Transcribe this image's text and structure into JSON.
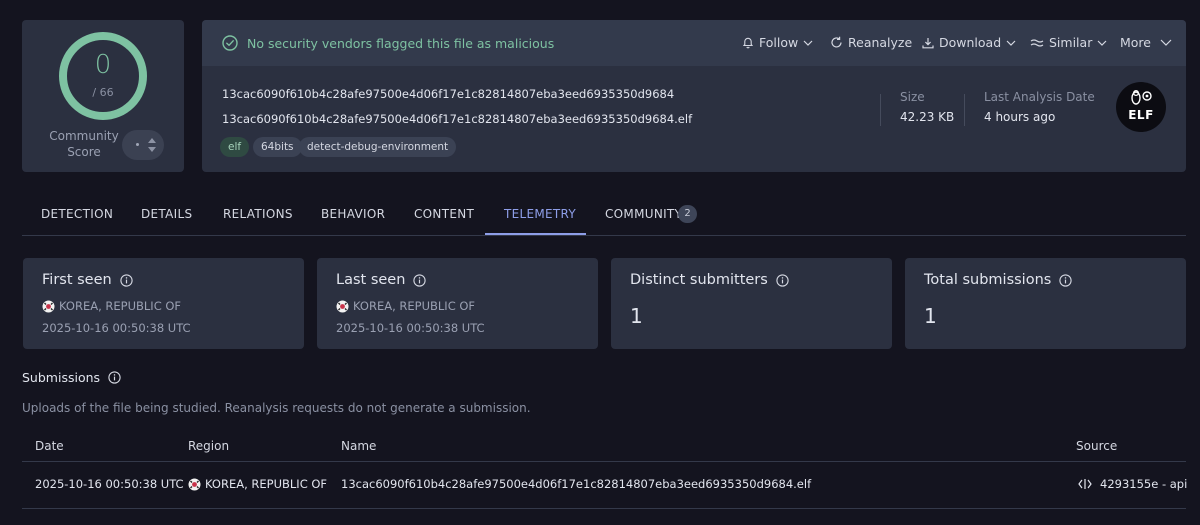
{
  "score": {
    "detections": "0",
    "total": "/ 66",
    "community_label": "Community Score",
    "ring_color": "#7ec2a2"
  },
  "banner": {
    "message": "No security vendors flagged this file as malicious",
    "status_color": "#7ec2a2",
    "actions": {
      "follow": "Follow",
      "reanalyze": "Reanalyze",
      "download": "Download",
      "similar": "Similar",
      "more": "More"
    }
  },
  "file": {
    "sha256": "13cac6090f610b4c28afe97500e4d06f17e1c82814807eba3eed6935350d9684",
    "filename": "13cac6090f610b4c28afe97500e4d06f17e1c82814807eba3eed6935350d9684.elf",
    "tags": [
      "elf",
      "64bits",
      "detect-debug-environment"
    ],
    "size_label": "Size",
    "size_value": "42.23 KB",
    "analysis_label": "Last Analysis Date",
    "analysis_value": "4 hours ago",
    "type_icon": "ELF"
  },
  "tabs": {
    "detection": "DETECTION",
    "details": "DETAILS",
    "relations": "RELATIONS",
    "behavior": "BEHAVIOR",
    "content": "CONTENT",
    "telemetry": "TELEMETRY",
    "community": "COMMUNITY",
    "community_count": "2",
    "active": "telemetry",
    "accent_color": "#8e9ee8"
  },
  "stats": {
    "first_seen": {
      "title": "First seen",
      "country": "KOREA, REPUBLIC OF",
      "date": "2025-10-16 00:50:38 UTC"
    },
    "last_seen": {
      "title": "Last seen",
      "country": "KOREA, REPUBLIC OF",
      "date": "2025-10-16 00:50:38 UTC"
    },
    "distinct_submitters": {
      "title": "Distinct submitters",
      "value": "1"
    },
    "total_submissions": {
      "title": "Total submissions",
      "value": "1"
    }
  },
  "submissions": {
    "title": "Submissions",
    "description": "Uploads of the file being studied. Reanalysis requests do not generate a submission.",
    "columns": {
      "date": "Date",
      "region": "Region",
      "name": "Name",
      "source": "Source"
    },
    "rows": [
      {
        "date": "2025-10-16 00:50:38 UTC",
        "region": "KOREA, REPUBLIC OF",
        "name": "13cac6090f610b4c28afe97500e4d06f17e1c82814807eba3eed6935350d9684.elf",
        "source": "4293155e - api"
      }
    ]
  }
}
